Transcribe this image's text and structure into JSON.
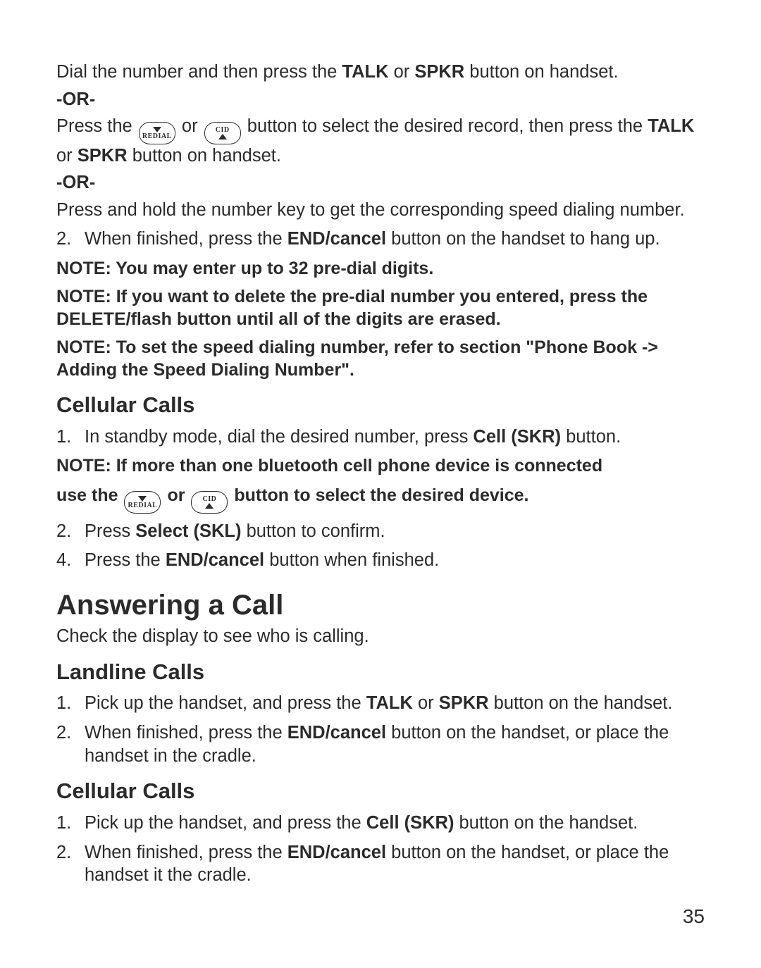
{
  "icons": {
    "redial_label": "REDIAL",
    "cid_label": "CID"
  },
  "top": {
    "step_dial_pre": "Dial the number and then press the ",
    "talk": "TALK",
    "mid_or": " or ",
    "spkr": "SPKR",
    "step_dial_post": " button on handset.",
    "or": "-OR-",
    "step_press_pre": "Press the ",
    "step_press_mid1": " or ",
    "step_press_mid2": " button to select the desired record, then press the ",
    "step_press_post": " button on handset.",
    "step_hold": "Press and hold the number key to get the corresponding speed dialing number.",
    "step2_num": "2.",
    "step2_pre": "When finished, press the ",
    "endcancel": "END/cancel",
    "step2_post": " button on the handset to hang up.",
    "note1": "NOTE: You may enter up to 32 pre-dial digits.",
    "note2": "NOTE: If you want to delete the pre-dial number you entered, press the DELETE/flash button until all of the digits are erased.",
    "note3": "NOTE: To set the speed dialing number, refer to section \"Phone Book -> Adding the Speed Dialing Number\"."
  },
  "cell1": {
    "heading": "Cellular Calls",
    "s1_num": "1.",
    "s1_pre": "In standby mode, dial the desired number, press ",
    "cell_skr": "Cell (SKR)",
    "s1_post": " button.",
    "note_line1": "NOTE: If more than one bluetooth cell phone device is connected",
    "note_line2_pre": "use the ",
    "note_line2_mid": " or ",
    "note_line2_post": " button to select the desired device.",
    "s2_num": "2.",
    "s2_pre": "Press ",
    "select_skl": "Select (SKL)",
    "s2_post": " button to confirm.",
    "s4_num": "4.",
    "s4_pre": "Press the ",
    "s4_post": " button when finished."
  },
  "answer": {
    "heading": "Answering a Call",
    "intro": "Check the display to see who is calling."
  },
  "land": {
    "heading": "Landline Calls",
    "s1_num": "1.",
    "s1_pre": "Pick up the handset, and press the ",
    "s1_mid": " or ",
    "s1_post": " button on the handset.",
    "s2_num": "2.",
    "s2_pre": "When finished, press the ",
    "s2_post": " button on the handset, or place the handset in the cradle."
  },
  "cell2": {
    "heading": "Cellular Calls",
    "s1_num": "1.",
    "s1_pre": "Pick up the handset, and press the ",
    "s1_post": " button on the handset.",
    "s2_num": "2.",
    "s2_pre": "When finished, press the ",
    "s2_post": " button on the handset, or place the handset it the cradle."
  },
  "page_number": "35"
}
